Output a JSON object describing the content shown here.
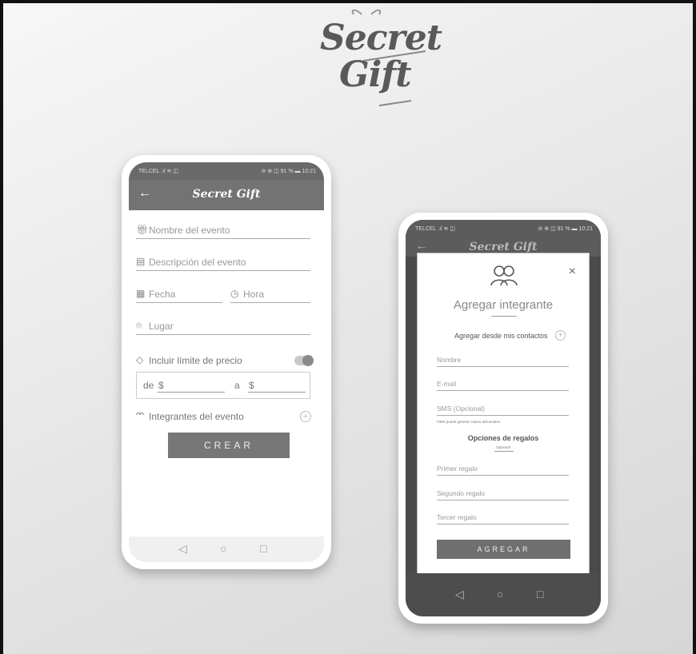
{
  "brand": {
    "line1": "Secret",
    "line2": "Gift"
  },
  "phone_create": {
    "status_left": "TELCEL .ıl ≋ ◫",
    "status_right": "⊘ ⊕ ◫ 91 % ▬ 10:21",
    "app_title": "Secret Gift",
    "fields": {
      "event_name": "Nombre del evento",
      "event_description": "Descripción del evento",
      "date": "Fecha",
      "time": "Hora",
      "place": "Lugar"
    },
    "price_limit_label": "Incluir límite de precio",
    "price_from_label": "de",
    "price_to_label": "a",
    "currency_symbol": "$",
    "members_label": "Integrantes del evento",
    "create_button": "CREAR"
  },
  "phone_add_member": {
    "status_left": "TELCEL .ıl ≋ ◫",
    "status_right": "⊘ ⊕ ◫ 91 % ▬ 10:21",
    "app_title": "Secret Gift",
    "modal": {
      "title": "Agregar integrante",
      "from_contacts": "Agregar desde mis contactos",
      "name_placeholder": "Nombre",
      "email_placeholder": "E-mail",
      "sms_placeholder": "SMS (Opcional)",
      "sms_note": "*SMS puede generar costos adicionales.",
      "gift_options_title": "Opciones de regalos",
      "gift_options_sub": "Opcional",
      "gift1": "Primer regalo",
      "gift2": "Segundo regalo",
      "gift3": "Tercer regalo",
      "add_button": "AGREGAR"
    }
  },
  "icons": {
    "back": "←",
    "close": "×",
    "plus": "+",
    "calendar": "▦",
    "clock": "◷",
    "location": "⌾",
    "tag": "◇",
    "people": "ᴖᴖ",
    "nav_back": "◁",
    "nav_home": "○",
    "nav_recent": "□"
  }
}
